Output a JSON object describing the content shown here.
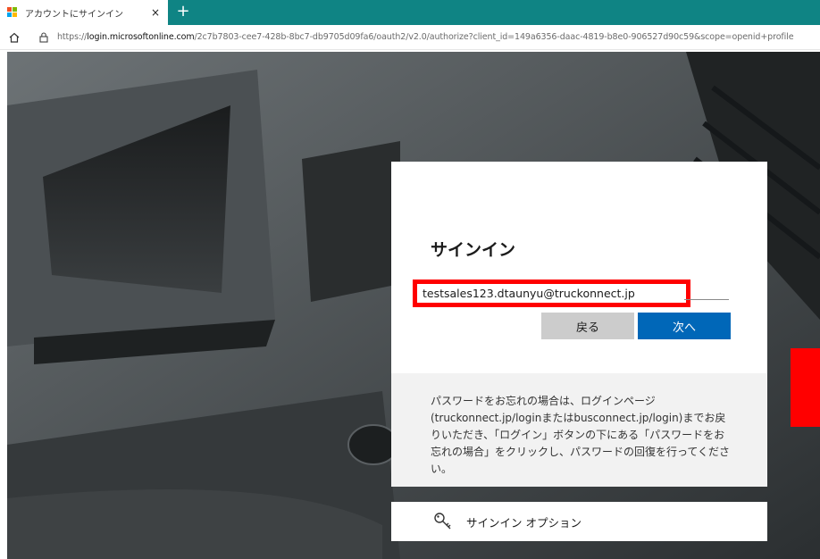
{
  "browser": {
    "tab_title": "アカウントにサインイン",
    "tab_close": "×",
    "new_tab": "+",
    "url_prefix": "https://",
    "url_host": "login.microsoftonline.com",
    "url_path": "/2c7b7803-cee7-428b-8bc7-db9705d09fa6/oauth2/v2.0/authorize?client_id=149a6356-daac-4819-b8e0-906527d90c59&scope=openid+profile"
  },
  "signin": {
    "title": "サインイン",
    "email_value": "testsales123.dtaunyu@truckonnect.jp",
    "back_label": "戻る",
    "next_label": "次へ"
  },
  "info": {
    "text": "パスワードをお忘れの場合は、ログインページ(truckonnect.jp/loginまたはbusconnect.jp/login)までお戻りいただき、「ログイン」ボタンの下にある「パスワードをお忘れの場合」をクリックし、パスワードの回復を行ってください。"
  },
  "options": {
    "label": "サインイン オプション",
    "icon": "key-icon"
  },
  "colors": {
    "tabstrip": "#0f8484",
    "primary_button": "#0067b8",
    "highlight": "#ff0000"
  }
}
